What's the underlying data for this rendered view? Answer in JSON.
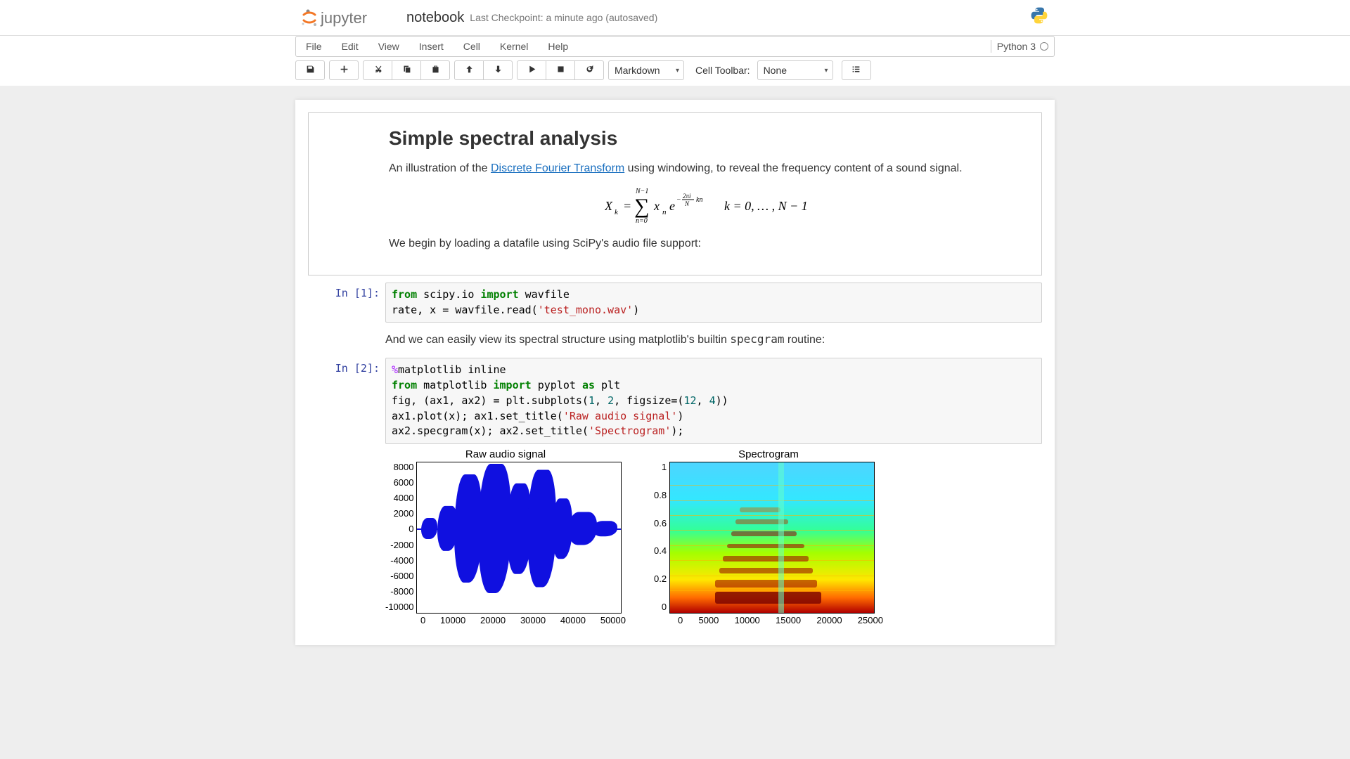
{
  "header": {
    "notebook_name": "notebook",
    "checkpoint": "Last Checkpoint: a minute ago (autosaved)"
  },
  "menubar": {
    "items": [
      "File",
      "Edit",
      "View",
      "Insert",
      "Cell",
      "Kernel",
      "Help"
    ],
    "kernel_name": "Python 3"
  },
  "toolbar": {
    "cell_type": "Markdown",
    "cell_toolbar_label": "Cell Toolbar:",
    "cell_toolbar_value": "None"
  },
  "cells": {
    "md1": {
      "title": "Simple spectral analysis",
      "p1_pre": "An illustration of the ",
      "p1_link": "Discrete Fourier Transform",
      "p1_post": " using windowing, to reveal the frequency content of a sound signal.",
      "p2": "We begin by loading a datafile using SciPy's audio file support:"
    },
    "code1": {
      "prompt": "In [1]:"
    },
    "md2": {
      "text_pre": "And we can easily view its spectral structure using matplotlib's builtin ",
      "code": "specgram",
      "text_post": " routine:"
    },
    "code2": {
      "prompt": "In [2]:"
    }
  },
  "chart_data": [
    {
      "type": "line",
      "title": "Raw audio signal",
      "xlim": [
        0,
        50000
      ],
      "ylim": [
        -10000,
        8000
      ],
      "yticks": [
        8000,
        6000,
        4000,
        2000,
        0,
        -2000,
        -4000,
        -6000,
        -8000,
        -10000
      ],
      "xticks": [
        0,
        10000,
        20000,
        30000,
        40000,
        50000
      ],
      "description": "Audio waveform oscillating around 0 with large amplitude bursts, peak approx +8000, trough approx -9000, densest between x≈8000 and x≈35000."
    },
    {
      "type": "heatmap",
      "title": "Spectrogram",
      "xlim": [
        0,
        25000
      ],
      "ylim": [
        0.0,
        1.0
      ],
      "yticks": [
        1.0,
        0.8,
        0.6,
        0.4,
        0.2,
        0.0
      ],
      "xticks": [
        0,
        5000,
        10000,
        15000,
        20000,
        25000
      ],
      "description": "Spectrogram heatmap (viridis-like colors) showing harmonic bands concentrated from x≈5000 to x≈20000, low frequencies bright (high energy), higher frequencies cooler."
    }
  ]
}
